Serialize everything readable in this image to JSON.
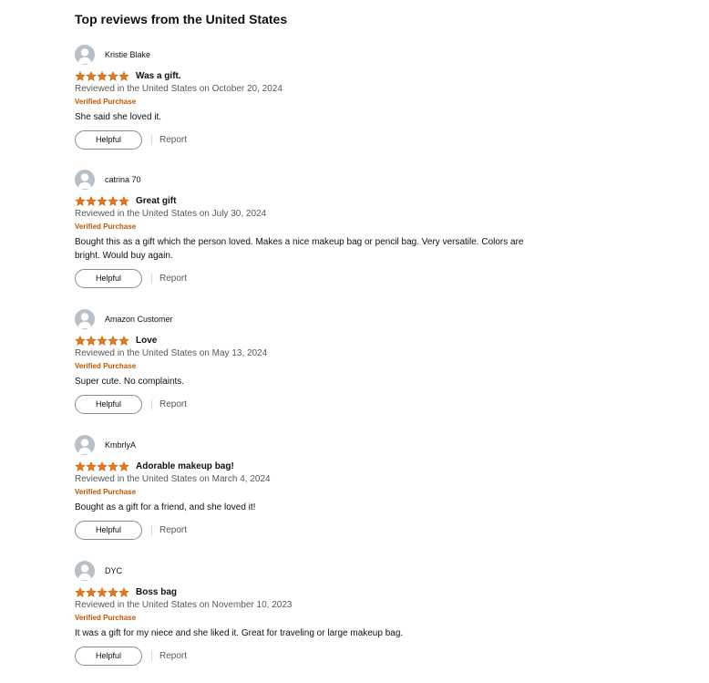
{
  "section_title": "Top reviews from the United States",
  "colors": {
    "star": "#de7921",
    "verified": "#c45500",
    "avatar": "#b7c0c7"
  },
  "reviews": [
    {
      "name": "Kristie Blake",
      "rating": 5,
      "title": "Was a gift.",
      "date": "Reviewed in the United States on October 20, 2024",
      "verified": "Verified Purchase",
      "text": "She said she loved it.",
      "helpful": "Helpful",
      "report": "Report"
    },
    {
      "name": "catrina 70",
      "rating": 5,
      "title": "Great gift",
      "date": "Reviewed in the United States on July 30, 2024",
      "verified": "Verified Purchase",
      "text": "Bought this as a gift which the person loved. Makes a nice makeup bag or pencil bag. Very versatile. Colors are bright. Would buy again.",
      "helpful": "Helpful",
      "report": "Report"
    },
    {
      "name": "Amazon Customer",
      "rating": 5,
      "title": "Love",
      "date": "Reviewed in the United States on May 13, 2024",
      "verified": "Verified Purchase",
      "text": "Super cute. No complaints.",
      "helpful": "Helpful",
      "report": "Report"
    },
    {
      "name": "KmbrlyA",
      "rating": 5,
      "title": "Adorable makeup bag!",
      "date": "Reviewed in the United States on March 4, 2024",
      "verified": "Verified Purchase",
      "text": "Bought as a gift for a friend, and she loved it!",
      "helpful": "Helpful",
      "report": "Report"
    },
    {
      "name": "DYC",
      "rating": 5,
      "title": "Boss bag",
      "date": "Reviewed in the United States on November 10, 2023",
      "verified": "Verified Purchase",
      "text": "It was a gift for my niece and she liked it. Great for traveling or large makeup bag.",
      "helpful": "Helpful",
      "report": "Report"
    }
  ]
}
